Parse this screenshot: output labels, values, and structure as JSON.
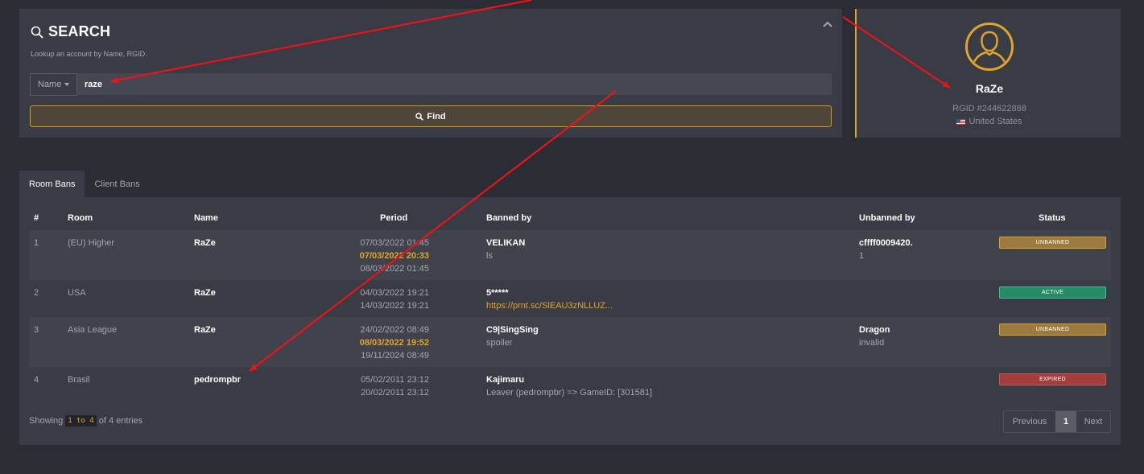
{
  "search": {
    "title": "SEARCH",
    "subtitle": "Lookup an account by Name, RGID.",
    "field_select": "Name",
    "query": "raze",
    "find_label": "Find"
  },
  "profile": {
    "name": "RaZe",
    "rgid": "RGID #244622888",
    "country": "United States"
  },
  "tabs": [
    "Room Bans",
    "Client Bans"
  ],
  "table": {
    "headers": {
      "num": "#",
      "room": "Room",
      "name": "Name",
      "period": "Period",
      "banned_by": "Banned by",
      "unbanned_by": "Unbanned by",
      "status": "Status"
    },
    "rows": [
      {
        "num": "1",
        "room": "(EU) Higher",
        "name": "RaZe",
        "periods": [
          {
            "date": "07/03/2022",
            "time": "01:45",
            "highlight": false
          },
          {
            "date": "07/03/2022",
            "time": "20:33",
            "highlight": true
          },
          {
            "date": "08/03/2022",
            "time": "01:45",
            "highlight": false
          }
        ],
        "banned_by": "VELIKAN",
        "reason": "ls",
        "unbanned_by": "cffff0009420.",
        "unban_reason": "1",
        "status": "UNBANNED"
      },
      {
        "num": "2",
        "room": "USA",
        "name": "RaZe",
        "periods": [
          {
            "date": "04/03/2022",
            "time": "19:21",
            "highlight": false
          },
          {
            "date": "14/03/2022",
            "time": "19:21",
            "highlight": false
          }
        ],
        "banned_by": "5*****",
        "reason": "https://prnt.sc/SlEAU3zNLLUZ...",
        "unbanned_by": "",
        "unban_reason": "",
        "status": "ACTIVE"
      },
      {
        "num": "3",
        "room": "Asia League",
        "name": "RaZe",
        "periods": [
          {
            "date": "24/02/2022",
            "time": "08:49",
            "highlight": false
          },
          {
            "date": "08/03/2022",
            "time": "19:52",
            "highlight": true
          },
          {
            "date": "19/11/2024",
            "time": "08:49",
            "highlight": false
          }
        ],
        "banned_by": "C9|SingSing",
        "reason": "spoiler",
        "unbanned_by": "Dragon",
        "unban_reason": "invalid",
        "status": "UNBANNED"
      },
      {
        "num": "4",
        "room": "Brasil",
        "name": "pedrompbr",
        "periods": [
          {
            "date": "05/02/2011",
            "time": "23:12",
            "highlight": false
          },
          {
            "date": "20/02/2011",
            "time": "23:12",
            "highlight": false
          }
        ],
        "banned_by": "Kajimaru",
        "reason": "Leaver (pedrompbr) => GameID: [301581]",
        "unbanned_by": "",
        "unban_reason": "",
        "status": "EXPIRED"
      }
    ]
  },
  "footer": {
    "showing_prefix": "Showing",
    "showing_range": "1 to 4",
    "showing_suffix": "of 4 entries",
    "pager": {
      "previous": "Previous",
      "page": "1",
      "next": "Next"
    }
  },
  "colors": {
    "accent": "#e0a42a",
    "annotation_arrow": "#e8141a",
    "status_active": "#268a66",
    "status_expired": "#a33e3e"
  }
}
